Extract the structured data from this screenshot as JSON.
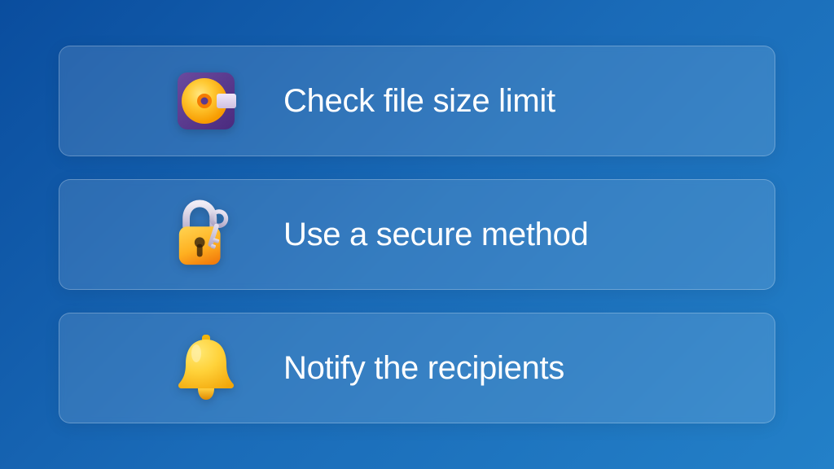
{
  "options": [
    {
      "label": "Check file size limit",
      "icon": "disc-icon"
    },
    {
      "label": "Use a secure method",
      "icon": "lock-key-icon"
    },
    {
      "label": "Notify the recipients",
      "icon": "bell-icon"
    }
  ]
}
